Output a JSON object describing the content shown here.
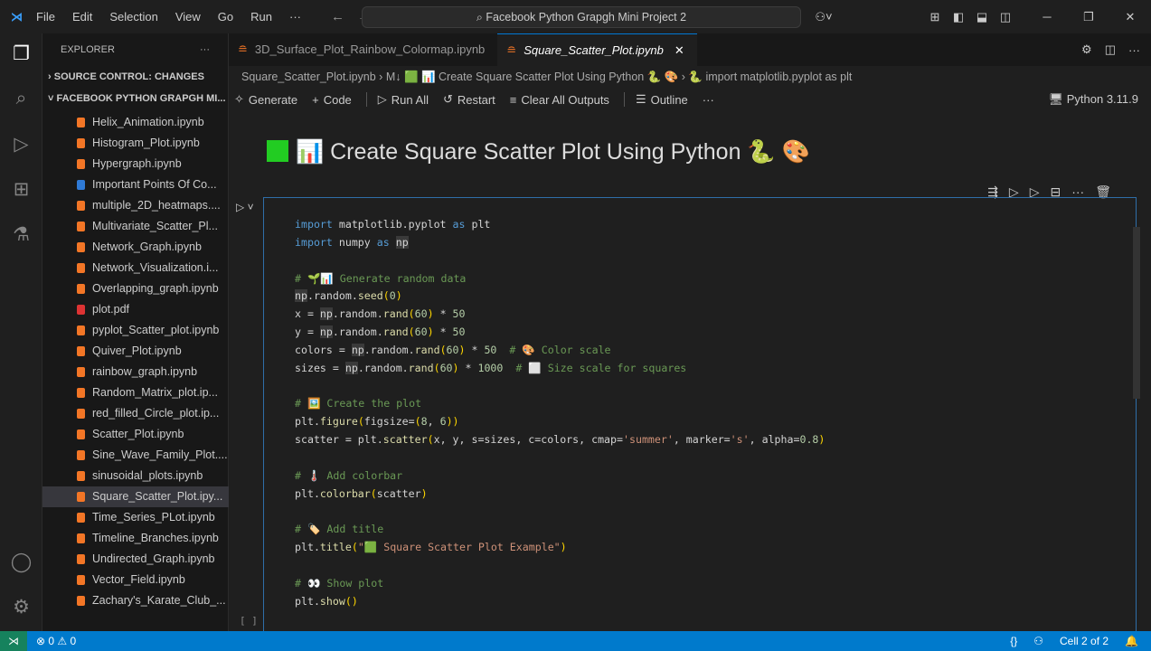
{
  "titlebar": {
    "menu": [
      "File",
      "Edit",
      "Selection",
      "View",
      "Go",
      "Run",
      "···"
    ],
    "search": "Facebook Python Grapgh Mini Project 2"
  },
  "sidebar": {
    "title": "EXPLORER",
    "source_control": "SOURCE CONTROL: CHANGES",
    "folder": "FACEBOOK PYTHON GRAPGH MI...",
    "files": [
      {
        "name": "Helix_Animation.ipynb",
        "type": "nb"
      },
      {
        "name": "Histogram_Plot.ipynb",
        "type": "nb"
      },
      {
        "name": "Hypergraph.ipynb",
        "type": "nb"
      },
      {
        "name": "Important Points Of Co...",
        "type": "info"
      },
      {
        "name": "multiple_2D_heatmaps....",
        "type": "nb"
      },
      {
        "name": "Multivariate_Scatter_Pl...",
        "type": "nb"
      },
      {
        "name": "Network_Graph.ipynb",
        "type": "nb"
      },
      {
        "name": "Network_Visualization.i...",
        "type": "nb"
      },
      {
        "name": "Overlapping_graph.ipynb",
        "type": "nb"
      },
      {
        "name": "plot.pdf",
        "type": "pdf"
      },
      {
        "name": "pyplot_Scatter_plot.ipynb",
        "type": "nb"
      },
      {
        "name": "Quiver_Plot.ipynb",
        "type": "nb"
      },
      {
        "name": "rainbow_graph.ipynb",
        "type": "nb"
      },
      {
        "name": "Random_Matrix_plot.ip...",
        "type": "nb"
      },
      {
        "name": "red_filled_Circle_plot.ip...",
        "type": "nb"
      },
      {
        "name": "Scatter_Plot.ipynb",
        "type": "nb"
      },
      {
        "name": "Sine_Wave_Family_Plot....",
        "type": "nb"
      },
      {
        "name": "sinusoidal_plots.ipynb",
        "type": "nb"
      },
      {
        "name": "Square_Scatter_Plot.ipy...",
        "type": "nb",
        "selected": true
      },
      {
        "name": "Time_Series_PLot.ipynb",
        "type": "nb"
      },
      {
        "name": "Timeline_Branches.ipynb",
        "type": "nb"
      },
      {
        "name": "Undirected_Graph.ipynb",
        "type": "nb"
      },
      {
        "name": "Vector_Field.ipynb",
        "type": "nb"
      },
      {
        "name": "Zachary's_Karate_Club_...",
        "type": "nb"
      }
    ]
  },
  "tabs": [
    {
      "label": "3D_Surface_Plot_Rainbow_Colormap.ipynb"
    },
    {
      "label": "Square_Scatter_Plot.ipynb",
      "active": true
    }
  ],
  "breadcrumb": "Square_Scatter_Plot.ipynb › M↓ 🟩 📊 Create Square Scatter Plot Using Python 🐍 🎨 › 🐍 import matplotlib.pyplot as plt",
  "toolbar": {
    "generate": "Generate",
    "code": "Code",
    "run_all": "Run All",
    "restart": "Restart",
    "clear": "Clear All Outputs",
    "outline": "Outline",
    "more": "···",
    "kernel": "Python 3.11.9"
  },
  "markdown_title": "📊 Create Square Scatter Plot Using Python 🐍 🎨",
  "code_lines": [
    [
      [
        "import",
        "k"
      ],
      [
        " matplotlib.pyplot ",
        ""
      ],
      [
        "as",
        "k"
      ],
      [
        " plt",
        ""
      ]
    ],
    [
      [
        "import",
        "k"
      ],
      [
        " numpy ",
        ""
      ],
      [
        "as",
        "k"
      ],
      [
        " ",
        ""
      ],
      [
        "np",
        "hl"
      ]
    ],
    [],
    [
      [
        "# 🌱📊 Generate random data",
        "c"
      ]
    ],
    [
      [
        "np",
        "hl"
      ],
      [
        ".random.",
        ""
      ],
      [
        "seed",
        "f"
      ],
      [
        "(",
        "p"
      ],
      [
        "0",
        "n"
      ],
      [
        ")",
        "p"
      ]
    ],
    [
      [
        "x = ",
        ""
      ],
      [
        "np",
        "hl"
      ],
      [
        ".random.",
        ""
      ],
      [
        "rand",
        "f"
      ],
      [
        "(",
        "p"
      ],
      [
        "60",
        "n"
      ],
      [
        ")",
        "p"
      ],
      [
        " * ",
        ""
      ],
      [
        "50",
        "n"
      ]
    ],
    [
      [
        "y = ",
        ""
      ],
      [
        "np",
        "hl"
      ],
      [
        ".random.",
        ""
      ],
      [
        "rand",
        "f"
      ],
      [
        "(",
        "p"
      ],
      [
        "60",
        "n"
      ],
      [
        ")",
        "p"
      ],
      [
        " * ",
        ""
      ],
      [
        "50",
        "n"
      ]
    ],
    [
      [
        "colors = ",
        ""
      ],
      [
        "np",
        "hl"
      ],
      [
        ".random.",
        ""
      ],
      [
        "rand",
        "f"
      ],
      [
        "(",
        "p"
      ],
      [
        "60",
        "n"
      ],
      [
        ")",
        "p"
      ],
      [
        " * ",
        ""
      ],
      [
        "50",
        "n"
      ],
      [
        "  # 🎨 Color scale",
        "c"
      ]
    ],
    [
      [
        "sizes = ",
        ""
      ],
      [
        "np",
        "hl"
      ],
      [
        ".random.",
        ""
      ],
      [
        "rand",
        "f"
      ],
      [
        "(",
        "p"
      ],
      [
        "60",
        "n"
      ],
      [
        ")",
        "p"
      ],
      [
        " * ",
        ""
      ],
      [
        "1000",
        "n"
      ],
      [
        "  # ⬜ Size scale for squares",
        "c"
      ]
    ],
    [],
    [
      [
        "# 🖼️ Create the plot",
        "c"
      ]
    ],
    [
      [
        "plt.",
        ""
      ],
      [
        "figure",
        "f"
      ],
      [
        "(",
        "p"
      ],
      [
        "figsize=",
        ""
      ],
      [
        "(",
        "p"
      ],
      [
        "8",
        "n"
      ],
      [
        ", ",
        ""
      ],
      [
        "6",
        "n"
      ],
      [
        ")",
        "p"
      ],
      [
        ")",
        "p"
      ]
    ],
    [
      [
        "scatter = plt.",
        ""
      ],
      [
        "scatter",
        "f"
      ],
      [
        "(",
        "p"
      ],
      [
        "x, y, s=sizes, c=colors, cmap=",
        ""
      ],
      [
        "'summer'",
        "s"
      ],
      [
        ", marker=",
        ""
      ],
      [
        "'s'",
        "s"
      ],
      [
        ", alpha=",
        ""
      ],
      [
        "0.8",
        "n"
      ],
      [
        ")",
        "p"
      ]
    ],
    [],
    [
      [
        "# 🌡️ Add colorbar",
        "c"
      ]
    ],
    [
      [
        "plt.",
        ""
      ],
      [
        "colorbar",
        "f"
      ],
      [
        "(",
        "p"
      ],
      [
        "scatter",
        ""
      ],
      [
        ")",
        "p"
      ]
    ],
    [],
    [
      [
        "# 🏷️ Add title",
        "c"
      ]
    ],
    [
      [
        "plt.",
        ""
      ],
      [
        "title",
        "f"
      ],
      [
        "(",
        "p"
      ],
      [
        "\"🟩 Square Scatter Plot Example\"",
        "s"
      ],
      [
        ")",
        "p"
      ]
    ],
    [],
    [
      [
        "# 👀 Show plot",
        "c"
      ]
    ],
    [
      [
        "plt.",
        ""
      ],
      [
        "show",
        "f"
      ],
      [
        "()",
        "p"
      ]
    ]
  ],
  "exec_count": "[ ]",
  "status": {
    "errors": "0",
    "warnings": "0",
    "cell": "Cell 2 of 2"
  }
}
